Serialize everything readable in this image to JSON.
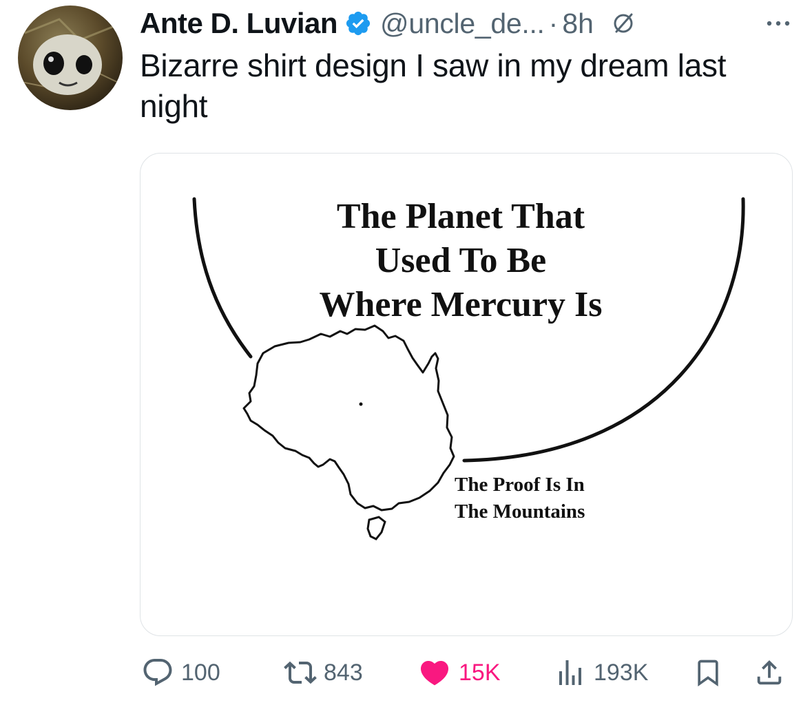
{
  "tweet": {
    "author": {
      "name": "Ante D. Luvian",
      "handle": "@uncle_de...",
      "verified": true
    },
    "separator": "·",
    "time": "8h",
    "text": "Bizarre shirt design I saw in my dream last night",
    "media": {
      "title_lines": [
        "The Planet That",
        "Used To Be",
        "Where Mercury Is"
      ],
      "tagline_lines": [
        "The Proof Is In",
        "The Mountains"
      ]
    },
    "stats": {
      "replies": "100",
      "reposts": "843",
      "likes": "15K",
      "views": "193K"
    }
  },
  "icons": {
    "verified": "verified-badge-icon",
    "grok": "no-entry-icon",
    "more": "more-dots-icon",
    "reply": "reply-bubble-icon",
    "repost": "repost-arrows-icon",
    "like": "heart-icon",
    "views": "bar-chart-icon",
    "bookmark": "bookmark-icon",
    "share": "share-icon"
  },
  "colors": {
    "text": "#0f1419",
    "secondary": "#536471",
    "verified": "#1d9bf0",
    "like": "#f91880",
    "border": "#dfe3e6"
  }
}
